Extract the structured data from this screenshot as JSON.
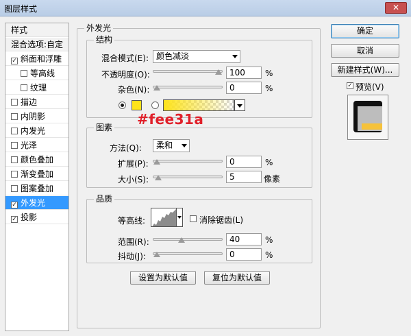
{
  "window": {
    "title": "图层样式",
    "close_glyph": "✕"
  },
  "sidebar": {
    "items": [
      {
        "label": "样式",
        "checkbox": false
      },
      {
        "label": "混合选项:自定",
        "checkbox": false
      },
      {
        "label": "斜面和浮雕",
        "checkbox": true,
        "checked": true
      },
      {
        "label": "等高线",
        "checkbox": true,
        "checked": false,
        "sub": true
      },
      {
        "label": "纹理",
        "checkbox": true,
        "checked": false,
        "sub": true
      },
      {
        "label": "描边",
        "checkbox": true,
        "checked": false
      },
      {
        "label": "内阴影",
        "checkbox": true,
        "checked": false
      },
      {
        "label": "内发光",
        "checkbox": true,
        "checked": false
      },
      {
        "label": "光泽",
        "checkbox": true,
        "checked": false
      },
      {
        "label": "颜色叠加",
        "checkbox": true,
        "checked": false
      },
      {
        "label": "渐变叠加",
        "checkbox": true,
        "checked": false
      },
      {
        "label": "图案叠加",
        "checkbox": true,
        "checked": false
      },
      {
        "label": "外发光",
        "checkbox": true,
        "checked": true,
        "selected": true
      },
      {
        "label": "投影",
        "checkbox": true,
        "checked": true
      }
    ]
  },
  "panel": {
    "title": "外发光",
    "structure": {
      "title": "结构",
      "blend_mode_label": "混合模式(E):",
      "blend_mode_value": "颜色减淡",
      "opacity_label": "不透明度(O):",
      "opacity_value": "100",
      "opacity_unit": "%",
      "opacity_fraction": 1.0,
      "noise_label": "杂色(N):",
      "noise_value": "0",
      "noise_unit": "%",
      "noise_fraction": 0.0,
      "color": "#fee31a",
      "color_annotation": "#fee31a"
    },
    "elements": {
      "title": "图素",
      "method_label": "方法(Q):",
      "method_value": "柔和",
      "spread_label": "扩展(P):",
      "spread_value": "0",
      "spread_unit": "%",
      "spread_fraction": 0.0,
      "size_label": "大小(S):",
      "size_value": "5",
      "size_unit": "像素",
      "size_fraction": 0.02
    },
    "quality": {
      "title": "品质",
      "contour_label": "等高线:",
      "anti_alias_label": "消除锯齿(L)",
      "anti_alias_checked": false,
      "range_label": "范围(R):",
      "range_value": "40",
      "range_unit": "%",
      "range_fraction": 0.4,
      "jitter_label": "抖动(J):",
      "jitter_value": "0",
      "jitter_unit": "%",
      "jitter_fraction": 0.0
    },
    "set_default_label": "设置为默认值",
    "reset_default_label": "复位为默认值"
  },
  "buttons": {
    "ok_label": "确定",
    "cancel_label": "取消",
    "new_style_label": "新建样式(W)...",
    "preview_label": "预览(V)",
    "preview_checked": true
  },
  "colors": {
    "selection": "#3399ff",
    "preview_accent": "#f6c23a"
  }
}
